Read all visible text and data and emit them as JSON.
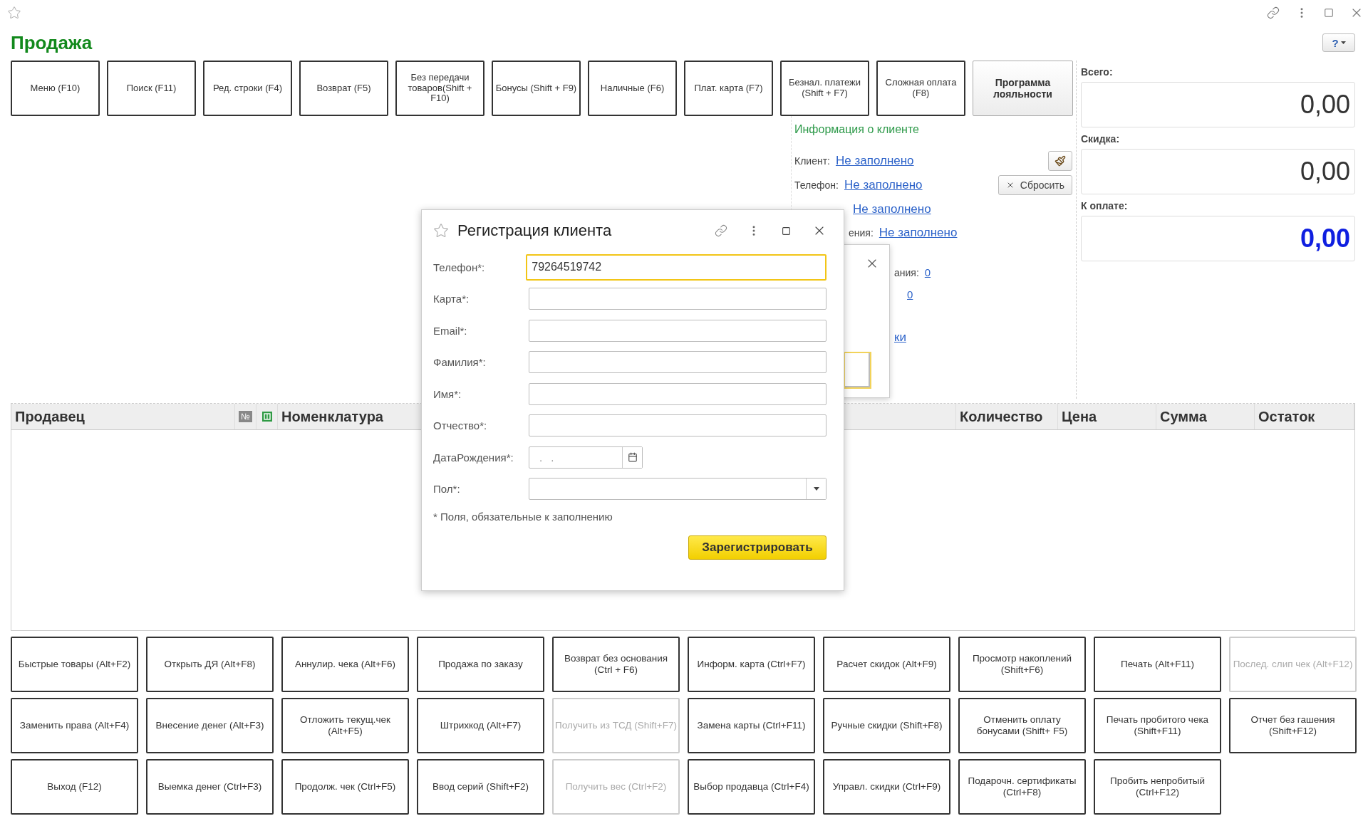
{
  "window": {
    "title": "Продажа",
    "help": "?"
  },
  "toolbar_buttons": [
    {
      "label": "Меню (F10)",
      "kind": "plain"
    },
    {
      "label": "Поиск (F11)",
      "kind": "plain"
    },
    {
      "label": "Ред. строки (F4)",
      "kind": "plain"
    },
    {
      "label": "Возврат (F5)",
      "kind": "plain"
    },
    {
      "label": "Без передачи товаров(Shift + F10)",
      "kind": "plain"
    },
    {
      "label": "Бонусы (Shift + F9)",
      "kind": "plain"
    },
    {
      "label": "Наличные (F6)",
      "kind": "plain"
    },
    {
      "label": "Плат. карта (F7)",
      "kind": "plain"
    },
    {
      "label": "Безнал. платежи (Shift + F7)",
      "kind": "plain"
    },
    {
      "label": "Сложная оплата (F8)",
      "kind": "plain"
    },
    {
      "label": "Программа лояльности",
      "kind": "accent"
    }
  ],
  "client_info": {
    "title": "Информация о клиенте",
    "reset_button": "Сбросить",
    "rows": [
      {
        "label": "Клиент:",
        "value": "Не заполнено"
      },
      {
        "label": "Телефон:",
        "value": "Не заполнено"
      }
    ],
    "partial_rows": [
      {
        "value": "Не заполнено"
      },
      {
        "label": "ения:",
        "value": "Не заполнено"
      }
    ],
    "counters": [
      {
        "label": "ания:",
        "value": "0"
      },
      {
        "value": "0"
      }
    ],
    "footer_link": "ки"
  },
  "totals": [
    {
      "label": "Всего:",
      "value": "0,00",
      "kind": "plain"
    },
    {
      "label": "Скидка:",
      "value": "0,00",
      "kind": "plain"
    },
    {
      "label": "К оплате:",
      "value": "0,00",
      "kind": "due"
    }
  ],
  "table": {
    "columns": [
      {
        "label": "Продавец",
        "kind": "text"
      },
      {
        "label": "№",
        "kind": "badge"
      },
      {
        "kind": "icon"
      },
      {
        "label": "Номенклатура",
        "kind": "wide"
      },
      {
        "label": "Количество",
        "kind": "text"
      },
      {
        "label": "Цена",
        "kind": "text"
      },
      {
        "label": "Сумма",
        "kind": "text"
      },
      {
        "label": "Остаток",
        "kind": "text"
      }
    ]
  },
  "actions": [
    [
      {
        "label": "Быстрые товары (Alt+F2)",
        "disabled": false
      },
      {
        "label": "Открыть ДЯ (Alt+F8)",
        "disabled": false
      },
      {
        "label": "Аннулир. чека (Alt+F6)",
        "disabled": false
      },
      {
        "label": "Продажа по заказу",
        "disabled": false
      },
      {
        "label": "Возврат без основания (Ctrl + F6)",
        "disabled": false
      },
      {
        "label": "Информ. карта (Ctrl+F7)",
        "disabled": false
      },
      {
        "label": "Расчет скидок (Alt+F9)",
        "disabled": false
      },
      {
        "label": "Просмотр накоплений (Shift+F6)",
        "disabled": false
      },
      {
        "label": "Печать (Alt+F11)",
        "disabled": false
      },
      {
        "label": "Послед. слип чек (Alt+F12)",
        "disabled": true
      }
    ],
    [
      {
        "label": "Заменить права (Alt+F4)",
        "disabled": false
      },
      {
        "label": "Внесение денег (Alt+F3)",
        "disabled": false
      },
      {
        "label": "Отложить текущ.чек (Alt+F5)",
        "disabled": false
      },
      {
        "label": "Штрихкод (Alt+F7)",
        "disabled": false
      },
      {
        "label": "Получить из ТСД (Shift+F7)",
        "disabled": true
      },
      {
        "label": "Замена карты (Ctrl+F11)",
        "disabled": false
      },
      {
        "label": "Ручные скидки (Shift+F8)",
        "disabled": false
      },
      {
        "label": "Отменить оплату бонусами (Shift+ F5)",
        "disabled": false
      },
      {
        "label": "Печать пробитого чека (Shift+F11)",
        "disabled": false
      },
      {
        "label": "Отчет без гашения (Shift+F12)",
        "disabled": false
      }
    ],
    [
      {
        "label": "Выход (F12)",
        "disabled": false
      },
      {
        "label": "Выемка денег (Ctrl+F3)",
        "disabled": false
      },
      {
        "label": "Продолж. чек (Ctrl+F5)",
        "disabled": false
      },
      {
        "label": "Ввод серий (Shift+F2)",
        "disabled": false
      },
      {
        "label": "Получить вес (Ctrl+F2)",
        "disabled": true
      },
      {
        "label": "Выбор продавца (Ctrl+F4)",
        "disabled": false
      },
      {
        "label": "Управл. скидки (Ctrl+F9)",
        "disabled": false
      },
      {
        "label": "Подарочн. сертификаты (Ctrl+F8)",
        "disabled": false
      },
      {
        "label": "Пробить непробитый (Ctrl+F12)",
        "disabled": false
      }
    ]
  ],
  "dialog": {
    "title": "Регистрация клиента",
    "fields": [
      {
        "label": "Телефон*:",
        "value": "79264519742",
        "kind": "text",
        "focused": true
      },
      {
        "label": "Карта*:",
        "kind": "text",
        "focused": false
      },
      {
        "label": "Email*:",
        "kind": "text",
        "focused": false
      },
      {
        "label": "Фамилия*:",
        "kind": "text",
        "focused": false
      },
      {
        "label": "Имя*:",
        "kind": "text",
        "focused": false
      },
      {
        "label": "Отчество*:",
        "kind": "text",
        "focused": false
      },
      {
        "label": "ДатаРождения*:",
        "placeholder": ". .",
        "kind": "date",
        "focused": false
      },
      {
        "label": "Пол*:",
        "kind": "select",
        "focused": false
      }
    ],
    "note": "* Поля, обязательные к заполнению",
    "submit": "Зарегистрировать"
  }
}
